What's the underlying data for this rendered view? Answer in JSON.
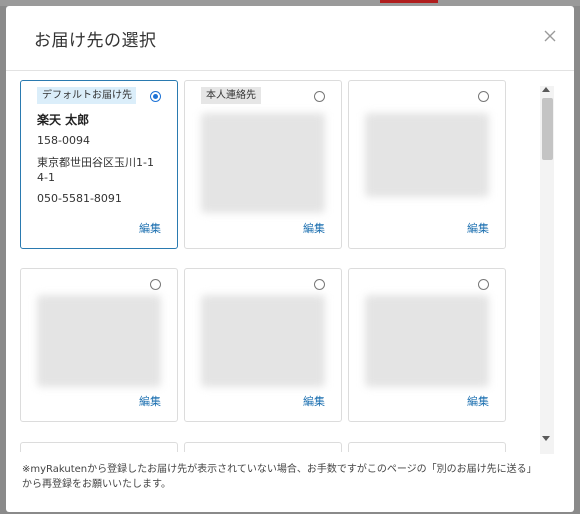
{
  "modal": {
    "title": "お届け先の選択",
    "close_icon": "close-icon"
  },
  "cards": [
    {
      "tag": "デフォルトお届け先",
      "selected": true,
      "name": "楽天 太郎",
      "postal_code": "158-0094",
      "address_line1": "東京都世田谷区玉川1-1",
      "address_line2": "4-1",
      "phone": "050-5581-8091",
      "edit_label": "編集"
    },
    {
      "tag": "本人連絡先",
      "selected": false,
      "edit_label": "編集"
    },
    {
      "selected": false,
      "edit_label": "編集"
    },
    {
      "selected": false,
      "edit_label": "編集"
    },
    {
      "selected": false,
      "edit_label": "編集"
    },
    {
      "selected": false,
      "edit_label": "編集"
    }
  ],
  "footnote": "※myRakutenから登録したお届け先が表示されていない場合、お手数ですがこのページの「別のお届け先に送る」から再登録をお願いいたします。",
  "colors": {
    "accent": "#1e73d6",
    "link": "#1b6fb0",
    "selected_border": "#2a7ab0",
    "default_tag_bg": "#dbeefa"
  }
}
